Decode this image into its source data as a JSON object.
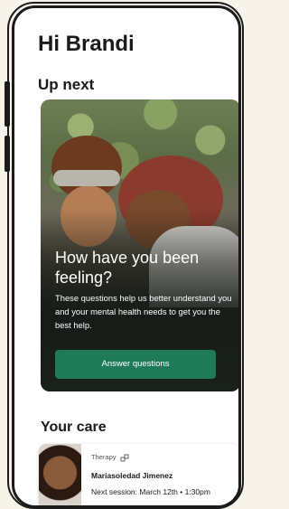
{
  "header": {
    "greeting": "Hi Brandi"
  },
  "up_next": {
    "section_title": "Up next",
    "card": {
      "title": "How have you been feeling?",
      "description": "These questions help us better understand you and your mental health needs to get you the best help.",
      "button_label": "Answer questions"
    }
  },
  "your_care": {
    "section_title": "Your care",
    "provider": {
      "type": "Therapy",
      "type_icon": "link-icon",
      "name": "Mariasoledad Jimenez",
      "next_session": "Next session: March 12th • 1:30pm"
    }
  },
  "colors": {
    "accent": "#1f7a5a",
    "text": "#1a1a1a",
    "background": "#ffffff"
  }
}
